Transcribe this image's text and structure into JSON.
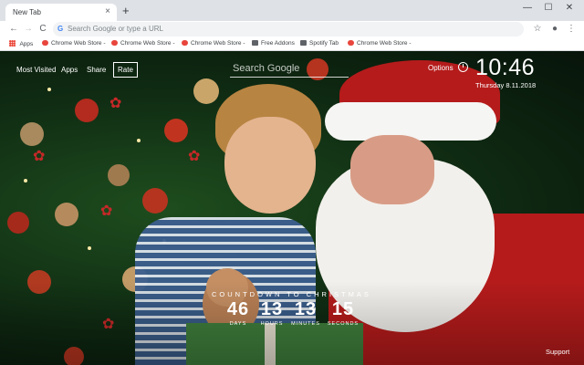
{
  "browser": {
    "tab_title": "New Tab",
    "tab_close": "×",
    "new_tab": "+",
    "window_controls": {
      "minimize": "—",
      "maximize": "☐",
      "close": "✕"
    },
    "nav": {
      "back": "←",
      "forward": "→",
      "reload": "C"
    },
    "omnibox_placeholder": "Search Google or type a URL",
    "google_g": "G",
    "star": "☆",
    "profile": "●",
    "menu": "⋮"
  },
  "bookmarks": {
    "apps_label": "Apps",
    "items": [
      {
        "label": "Chrome Web Store -",
        "color": "#e8453c"
      },
      {
        "label": "Chrome Web Store -",
        "color": "#e8453c"
      },
      {
        "label": "Chrome Web Store -",
        "color": "#e8453c"
      },
      {
        "label": "Free Addons",
        "color": "#5f6368"
      },
      {
        "label": "Spotify Tab",
        "color": "#5f6368"
      },
      {
        "label": "Chrome Web Store -",
        "color": "#e8453c"
      }
    ]
  },
  "newtab": {
    "nav": {
      "most_visited": "Most Visited",
      "apps": "Apps",
      "share": "Share",
      "rate": "Rate"
    },
    "search_placeholder": "Search Google",
    "options": "Options",
    "clock": {
      "time": "10:46",
      "date": "Thursday  8.11.2018"
    },
    "countdown": {
      "title": "COUNTDOWN TO CHRISTMAS",
      "days": "46",
      "hours": "13",
      "minutes": "13",
      "seconds": "15",
      "days_label": "DAYS",
      "hours_label": "HOURS",
      "minutes_label": "MINUTES",
      "seconds_label": "SECONDS"
    },
    "support": "Support"
  },
  "colors": {
    "tab_strip": "#dee1e6",
    "santa_red": "#b51b1b",
    "tree_green": "#1e4d1e"
  }
}
